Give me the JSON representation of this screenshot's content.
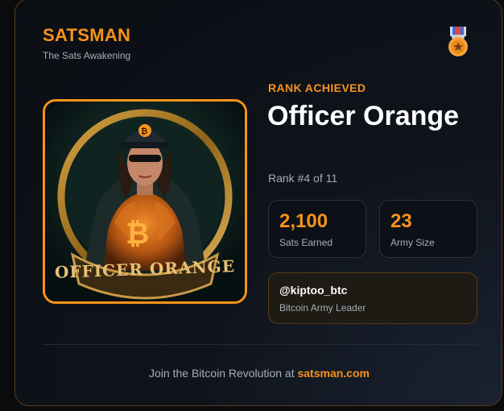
{
  "brand": {
    "title": "SATSMAN",
    "subtitle": "The Sats Awakening"
  },
  "icons": {
    "medal": "medal-icon",
    "portrait": "officer-orange-portrait"
  },
  "portrait": {
    "banner_text": "OFFICER ORANGE",
    "badge_symbol": "₿"
  },
  "rank": {
    "label": "RANK ACHIEVED",
    "title": "Officer Orange",
    "position": "Rank #4 of 11"
  },
  "stats": [
    {
      "value": "2,100",
      "label": "Sats Earned"
    },
    {
      "value": "23",
      "label": "Army Size"
    }
  ],
  "user": {
    "handle": "@kiptoo_btc",
    "role": "Bitcoin Army Leader"
  },
  "footer": {
    "text": "Join the Bitcoin Revolution at ",
    "link": "satsman.com"
  },
  "colors": {
    "accent": "#f7931a",
    "background": "#0f141c",
    "text": "#ffffff",
    "muted": "#a7adb8"
  }
}
